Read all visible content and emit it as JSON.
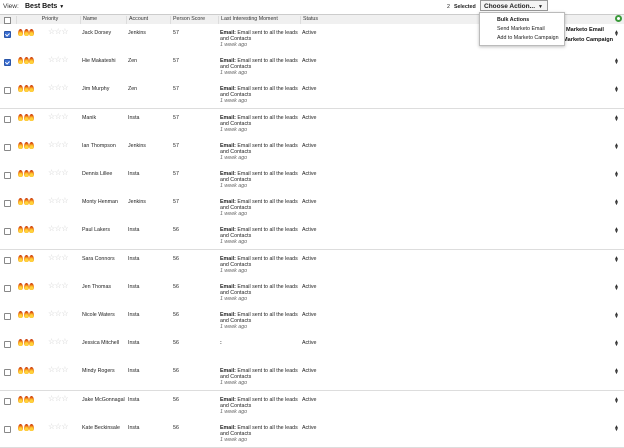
{
  "view": {
    "label": "View:",
    "value": "Best Bets"
  },
  "selection": {
    "count": "2",
    "label": "Selected"
  },
  "choose_action": {
    "label": "Choose Action..."
  },
  "dropdown": {
    "heading": "Bulk Actions",
    "items": [
      "Send Marketo Email",
      "Add to Marketo Campaign"
    ],
    "peek": [
      "Marketo Email",
      "Marketo Campaign"
    ]
  },
  "columns": {
    "priority": "Priority",
    "name": "Name",
    "account": "Account",
    "score": "Person Score",
    "moment": "Last Interesting Moment",
    "status": "Status"
  },
  "rows": [
    {
      "checked": true,
      "name": "Jack Dorsey",
      "account": "Jenkins",
      "score": "57",
      "moment_type": "Email:",
      "moment_text": "Email sent to all the leads and Contacts",
      "moment_ago": "1 week ago",
      "status": "Active"
    },
    {
      "checked": true,
      "name": "Hie Makateshi",
      "account": "Zen",
      "score": "57",
      "moment_type": "Email:",
      "moment_text": "Email sent to all the leads and Contacts",
      "moment_ago": "1 week ago",
      "status": "Active"
    },
    {
      "checked": false,
      "name": "Jim Murphy",
      "account": "Zen",
      "score": "57",
      "moment_type": "Email:",
      "moment_text": "Email sent to all the leads and Contacts",
      "moment_ago": "1 week ago",
      "status": "Active"
    },
    {
      "checked": false,
      "name": "Manik",
      "account": "Insta",
      "score": "57",
      "moment_type": "Email:",
      "moment_text": "Email sent to all the leads and Contacts",
      "moment_ago": "1 week ago",
      "status": "Active"
    },
    {
      "checked": false,
      "name": "Ian Thompson",
      "account": "Jenkins",
      "score": "57",
      "moment_type": "Email:",
      "moment_text": "Email sent to all the leads and Contacts",
      "moment_ago": "1 week ago",
      "status": "Active"
    },
    {
      "checked": false,
      "name": "Dennis Lillee",
      "account": "Insta",
      "score": "57",
      "moment_type": "Email:",
      "moment_text": "Email sent to all the leads and Contacts",
      "moment_ago": "1 week ago",
      "status": "Active"
    },
    {
      "checked": false,
      "name": "Monty Henman",
      "account": "Jenkins",
      "score": "57",
      "moment_type": "Email:",
      "moment_text": "Email sent to all the leads and Contacts",
      "moment_ago": "1 week ago",
      "status": "Active"
    },
    {
      "checked": false,
      "name": "Paul Lakers",
      "account": "Insta",
      "score": "56",
      "moment_type": "Email:",
      "moment_text": "Email sent to all the leads and Contacts",
      "moment_ago": "1 week ago",
      "status": "Active"
    },
    {
      "checked": false,
      "name": "Sara Connors",
      "account": "Insta",
      "score": "56",
      "moment_type": "Email:",
      "moment_text": "Email sent to all the leads and Contacts",
      "moment_ago": "1 week ago",
      "status": "Active"
    },
    {
      "checked": false,
      "name": "Jen Thomas",
      "account": "Insta",
      "score": "56",
      "moment_type": "Email:",
      "moment_text": "Email sent to all the leads and Contacts",
      "moment_ago": "1 week ago",
      "status": "Active"
    },
    {
      "checked": false,
      "name": "Nicole Waters",
      "account": "Insta",
      "score": "56",
      "moment_type": "Email:",
      "moment_text": "Email sent to all the leads and Contacts",
      "moment_ago": "1 week ago",
      "status": "Active"
    },
    {
      "checked": false,
      "name": "Jessica Mitchell",
      "account": "Insta",
      "score": "56",
      "moment_type": ":",
      "moment_text": "",
      "moment_ago": "",
      "status": "Active"
    },
    {
      "checked": false,
      "name": "Mindy Rogers",
      "account": "Insta",
      "score": "56",
      "moment_type": "Email:",
      "moment_text": "Email sent to all the leads and Contacts",
      "moment_ago": "1 week ago",
      "status": "Active"
    },
    {
      "checked": false,
      "name": "Jake McGonnagal",
      "account": "Insta",
      "score": "56",
      "moment_type": "Email:",
      "moment_text": "Email sent to all the leads and Contacts",
      "moment_ago": "1 week ago",
      "status": "Active"
    },
    {
      "checked": false,
      "name": "Kate Beckinsale",
      "account": "Insta",
      "score": "56",
      "moment_type": "Email:",
      "moment_text": "Email sent to all the leads and Contacts",
      "moment_ago": "1 week ago",
      "status": "Active"
    }
  ],
  "colors": {
    "checkbox_checked": "#3b6fd4",
    "refresh": "#3a9a3a",
    "header_bg": "#f0f0f0"
  }
}
